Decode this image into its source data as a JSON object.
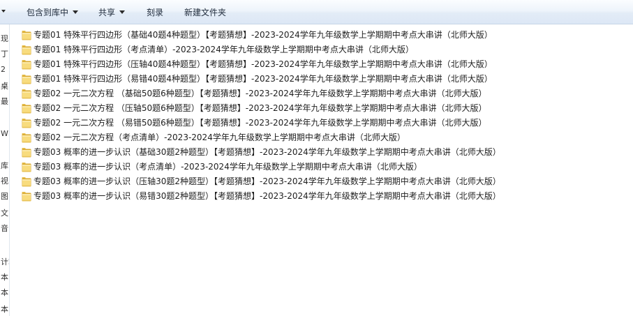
{
  "toolbar": {
    "library_label": "包含到库中",
    "share_label": "共享",
    "burn_label": "刻录",
    "new_folder_label": "新建文件夹"
  },
  "nav_glyphs": [
    "现",
    "丁",
    "2",
    "桌",
    "最",
    "WF",
    "库",
    "视",
    "图",
    "文",
    "音",
    "计算",
    "本",
    "本",
    "本"
  ],
  "icons": {
    "folder": "folder-icon",
    "dropdown": "chevron-down-icon"
  },
  "colors": {
    "folder_light": "#f8dc7e",
    "folder_dark": "#d9a930",
    "toolbar_top": "#fbfdff",
    "toolbar_bottom": "#dce7f5"
  },
  "files": [
    {
      "name": "专题01 特殊平行四边形（基础40题4种题型）【考题猜想】-2023-2024学年九年级数学上学期期中考点大串讲（北师大版）"
    },
    {
      "name": "专题01 特殊平行四边形（考点清单）-2023-2024学年九年级数学上学期期中考点大串讲（北师大版）"
    },
    {
      "name": "专题01 特殊平行四边形（压轴40题4种题型）【考题猜想】-2023-2024学年九年级数学上学期期中考点大串讲（北师大版）"
    },
    {
      "name": "专题01 特殊平行四边形（易错40题4种题型）【考题猜想】-2023-2024学年九年级数学上学期期中考点大串讲（北师大版）"
    },
    {
      "name": "专题02 一元二次方程 （基础50题6种题型）【考题猜想】-2023-2024学年九年级数学上学期期中考点大串讲（北师大版）"
    },
    {
      "name": "专题02 一元二次方程 （压轴50题6种题型）【考题猜想】-2023-2024学年九年级数学上学期期中考点大串讲（北师大版）"
    },
    {
      "name": "专题02 一元二次方程 （易错50题6种题型）【考题猜想】-2023-2024学年九年级数学上学期期中考点大串讲（北师大版）"
    },
    {
      "name": "专题02 一元二次方程（考点清单）-2023-2024学年九年级数学上学期期中考点大串讲（北师大版）"
    },
    {
      "name": "专题03 概率的进一步认识（基础30题2种题型）【考题猜想】-2023-2024学年九年级数学上学期期中考点大串讲（北师大版）"
    },
    {
      "name": "专题03 概率的进一步认识（考点清单）-2023-2024学年九年级数学上学期期中考点大串讲（北师大版）"
    },
    {
      "name": "专题03 概率的进一步认识（压轴30题2种题型）【考题猜想】-2023-2024学年九年级数学上学期期中考点大串讲（北师大版）"
    },
    {
      "name": "专题03 概率的进一步认识（易错30题2种题型）【考题猜想】-2023-2024学年九年级数学上学期期中考点大串讲（北师大版）"
    }
  ]
}
